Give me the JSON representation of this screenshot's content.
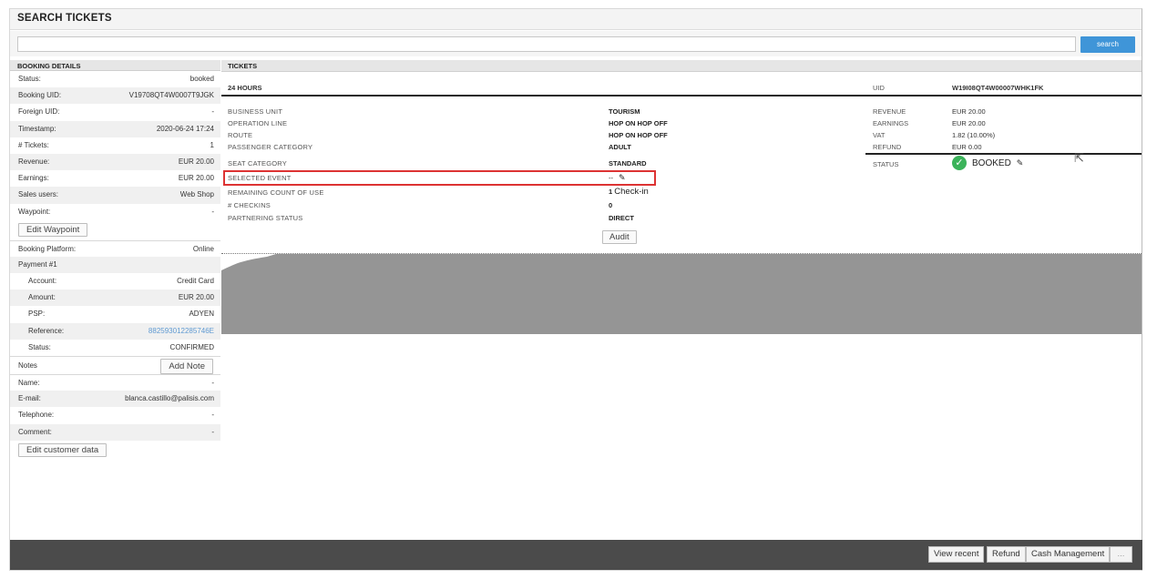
{
  "page": {
    "title": "SEARCH TICKETS"
  },
  "search": {
    "placeholder": "",
    "button_label": "search"
  },
  "booking_details": {
    "header": "BOOKING DETAILS",
    "rows": [
      {
        "label": "Status:",
        "value": "booked"
      },
      {
        "label": "Booking UID:",
        "value": "V19708QT4W0007T9JGK"
      },
      {
        "label": "Foreign UID:",
        "value": "-"
      },
      {
        "label": "Timestamp:",
        "value": "2020-06-24 17:24"
      },
      {
        "label": "# Tickets:",
        "value": "1"
      },
      {
        "label": "Revenue:",
        "value": "EUR 20.00"
      },
      {
        "label": "Earnings:",
        "value": "EUR 20.00"
      },
      {
        "label": "Sales users:",
        "value": "Web Shop"
      },
      {
        "label": "Waypoint:",
        "value": "-"
      }
    ],
    "edit_waypoint": "Edit Waypoint",
    "platform": {
      "label": "Booking Platform:",
      "value": "Online"
    },
    "payment_header": "Payment #1",
    "payment": [
      {
        "label": "Account:",
        "value": "Credit Card"
      },
      {
        "label": "Amount:",
        "value": "EUR 20.00"
      },
      {
        "label": "PSP:",
        "value": "ADYEN"
      },
      {
        "label": "Reference:",
        "value": "882593012285746E"
      },
      {
        "label": "Status:",
        "value": "CONFIRMED"
      }
    ],
    "notes": {
      "label": "Notes",
      "button": "Add Note"
    },
    "customer": [
      {
        "label": "Name:",
        "value": "-"
      },
      {
        "label": "E-mail:",
        "value": "blanca.castillo@palisis.com"
      },
      {
        "label": "Telephone:",
        "value": "-"
      },
      {
        "label": "Comment:",
        "value": "-"
      }
    ],
    "edit_customer": "Edit customer data"
  },
  "tickets": {
    "header": "TICKETS",
    "ticket_title": "24 HOURS",
    "uid_label": "UID",
    "uid_value": "W19I08QT4W00007WHK1FK",
    "fields": [
      {
        "label": "BUSINESS UNIT",
        "value": "TOURISM"
      },
      {
        "label": "OPERATION LINE",
        "value": "HOP ON HOP OFF"
      },
      {
        "label": "ROUTE",
        "value": "HOP ON HOP OFF"
      },
      {
        "label": "PASSENGER CATEGORY",
        "value": "ADULT"
      },
      {
        "label": "SEAT CATEGORY",
        "value": "STANDARD"
      },
      {
        "label": "SELECTED EVENT",
        "value": "--"
      },
      {
        "label": "REMAINING COUNT OF USE",
        "value": "1",
        "extra": "Check-in"
      },
      {
        "label": "# CHECKINS",
        "value": "0"
      },
      {
        "label": "PARTNERING STATUS",
        "value": "DIRECT"
      }
    ],
    "audit_button": "Audit",
    "financial": [
      {
        "label": "REVENUE",
        "value": "EUR 20.00"
      },
      {
        "label": "EARNINGS",
        "value": "EUR 20.00"
      },
      {
        "label": "VAT",
        "value": "1.82 (10.00%)"
      },
      {
        "label": "REFUND",
        "value": "EUR 0.00"
      }
    ],
    "status_label": "STATUS",
    "status_value": "BOOKED",
    "status_color": "#3bb35a"
  },
  "footer": {
    "buttons": [
      "View recent",
      "Refund",
      "Cash Management",
      "..."
    ]
  }
}
